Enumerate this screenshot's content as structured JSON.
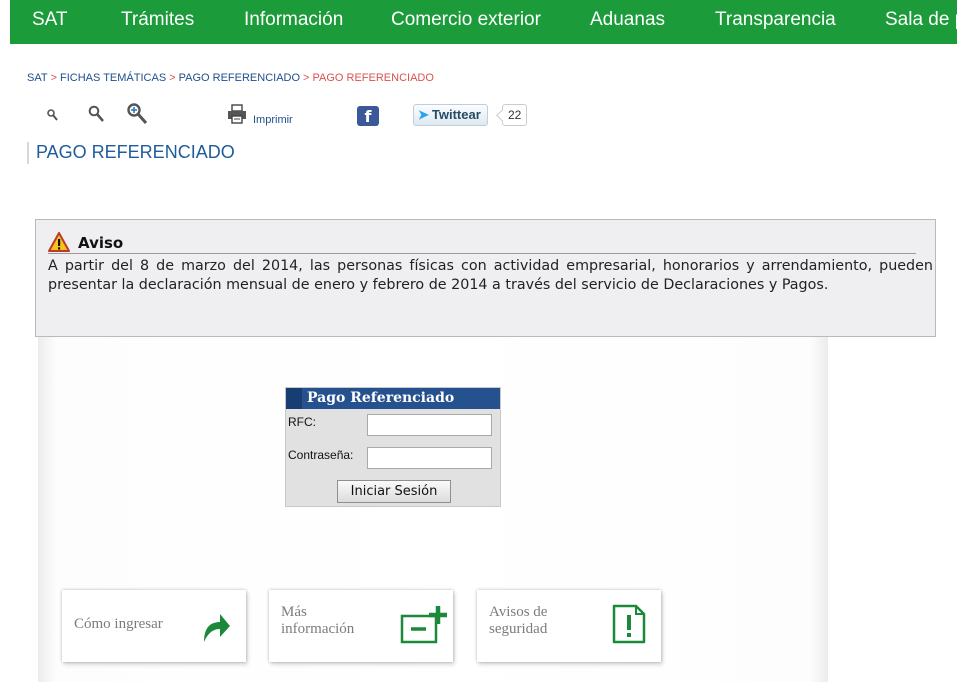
{
  "nav": {
    "items": [
      "SAT",
      "Trámites",
      "Información",
      "Comercio exterior",
      "Aduanas",
      "Transparencia",
      "Sala de p"
    ]
  },
  "breadcrumb": {
    "items": [
      "SAT",
      "FICHAS TEMÁTICAS",
      "PAGO REFERENCIADO"
    ],
    "current": "PAGO REFERENCIADO",
    "separator": ">"
  },
  "toolbar": {
    "print_label": "Imprimir",
    "tweet_label": "Twittear",
    "tweet_count": "22",
    "facebook_glyph": "f"
  },
  "page": {
    "title": "PAGO REFERENCIADO"
  },
  "notice": {
    "title": "Aviso",
    "text": "A partir del 8 de marzo del 2014, las personas físicas con actividad empresarial, honorarios y arrendamiento, pueden presentar la declaración mensual de enero y febrero de 2014 a través del servicio de Declaraciones y Pagos."
  },
  "login": {
    "title": "Pago Referenciado",
    "rfc_label": "RFC:",
    "rfc_value": "",
    "password_label": "Contraseña:",
    "password_value": "",
    "submit_label": "Iniciar Sesión"
  },
  "cards": [
    {
      "label_lines": [
        "Cómo ingresar"
      ],
      "icon": "arrow-icon"
    },
    {
      "label_lines": [
        "Más",
        "información"
      ],
      "icon": "folder-plus-icon"
    },
    {
      "label_lines": [
        "Avisos de",
        "seguridad"
      ],
      "icon": "document-alert-icon"
    }
  ],
  "colors": {
    "nav_green": "#1c9b3a",
    "link_blue": "#1e4f8c",
    "breadcrumb_current": "#d9534f",
    "login_header": "#26518f",
    "card_icon_green": "#1a8a3a"
  }
}
